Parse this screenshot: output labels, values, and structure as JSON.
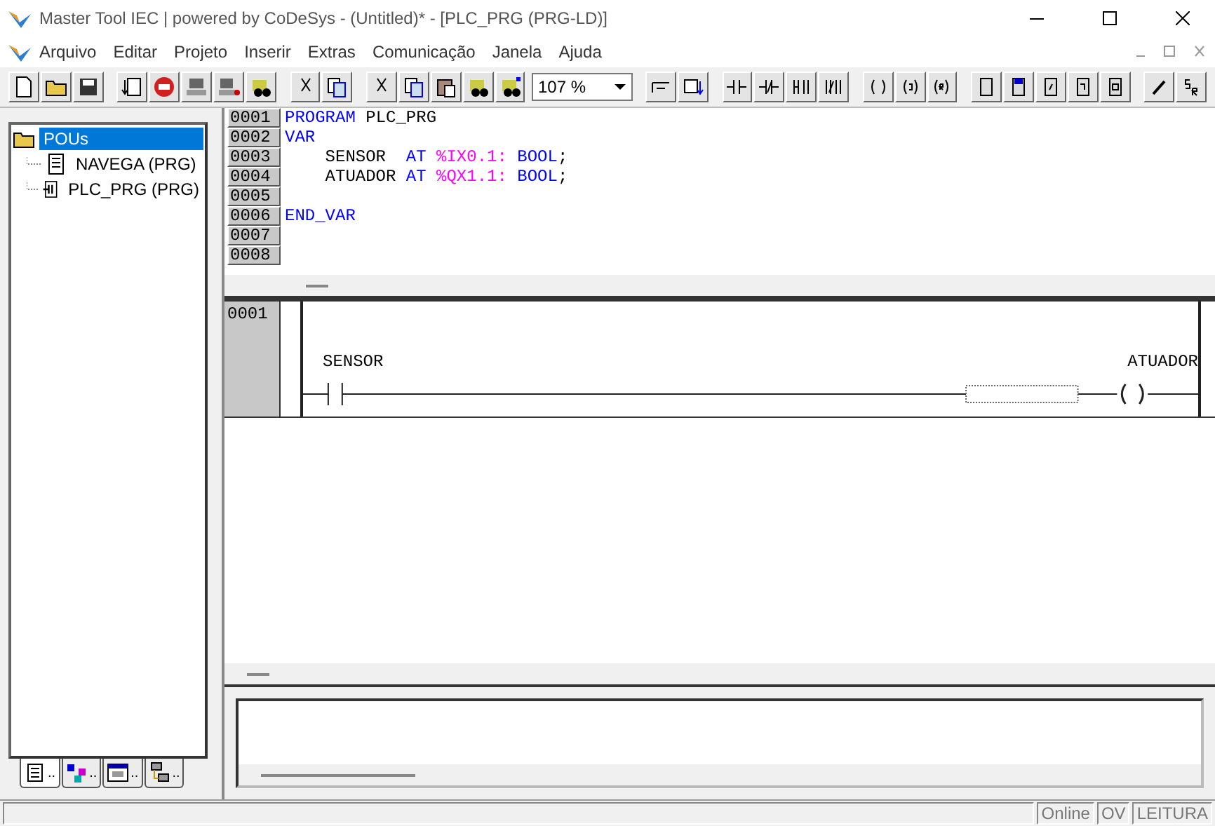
{
  "window": {
    "title": "Master Tool IEC | powered by CoDeSys - (Untitled)* - [PLC_PRG (PRG-LD)]"
  },
  "menu": [
    "Arquivo",
    "Editar",
    "Projeto",
    "Inserir",
    "Extras",
    "Comunicação",
    "Janela",
    "Ajuda"
  ],
  "toolbar": {
    "zoom": "107 %"
  },
  "tree": {
    "label": "POUs",
    "selected": true,
    "expanded": true,
    "children": [
      {
        "label": "NAVEGA (PRG)",
        "kind": "text",
        "selected": false
      },
      {
        "label": "PLC_PRG (PRG)",
        "kind": "ladder",
        "selected": false
      }
    ]
  },
  "object_tabs": [
    {
      "label": "..",
      "kind": "pous",
      "selected": true
    },
    {
      "label": "..",
      "kind": "types",
      "selected": false
    },
    {
      "label": "..",
      "kind": "visual",
      "selected": false
    },
    {
      "label": "..",
      "kind": "resources",
      "selected": false
    }
  ],
  "declaration": [
    {
      "number": "0001",
      "tokens": [
        {
          "kind": "keyword",
          "text": "PROGRAM"
        },
        {
          "kind": "plain",
          "text": " PLC_PRG"
        }
      ]
    },
    {
      "number": "0002",
      "tokens": [
        {
          "kind": "keyword",
          "text": "VAR"
        }
      ]
    },
    {
      "number": "0003",
      "tokens": [
        {
          "kind": "plain",
          "text": "    SENSOR  "
        },
        {
          "kind": "keyword",
          "text": "AT"
        },
        {
          "kind": "address",
          "text": " %IX0.1:"
        },
        {
          "kind": "keyword",
          "text": " BOOL"
        },
        {
          "kind": "plain",
          "text": ";"
        }
      ]
    },
    {
      "number": "0004",
      "tokens": [
        {
          "kind": "plain",
          "text": "    ATUADOR "
        },
        {
          "kind": "keyword",
          "text": "AT"
        },
        {
          "kind": "address",
          "text": " %QX1.1:"
        },
        {
          "kind": "keyword",
          "text": " BOOL"
        },
        {
          "kind": "plain",
          "text": ";"
        }
      ]
    },
    {
      "number": "0005"
    },
    {
      "number": "0006",
      "tokens": [
        {
          "kind": "keyword",
          "text": "END_VAR"
        }
      ]
    },
    {
      "number": "0007"
    },
    {
      "number": "0008"
    }
  ],
  "ladder": {
    "networks": [
      {
        "number": "0001",
        "contact": "SENSOR",
        "coil": "ATUADOR"
      }
    ]
  },
  "status_bar": [
    {
      "label": "Online",
      "disabled": true
    },
    {
      "label": "OV",
      "disabled": true
    },
    {
      "label": "LEITURA",
      "disabled": true
    }
  ]
}
